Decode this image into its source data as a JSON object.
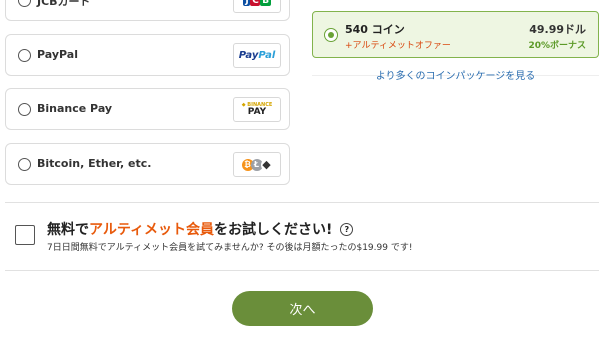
{
  "payment_methods": [
    {
      "label": "JCBカード",
      "logo": "jcb-logo",
      "logo_parts": [
        "J",
        "C",
        "B"
      ]
    },
    {
      "label": "PayPal",
      "logo": "paypal-logo",
      "logo_text_a": "Pay",
      "logo_text_b": "Pal"
    },
    {
      "label": "Binance Pay",
      "logo": "binance-logo",
      "logo_text_top": "◆ BINANCE",
      "logo_text_main": "PAY"
    },
    {
      "label": "Bitcoin, Ether, etc.",
      "logo": "crypto-logo",
      "coins": [
        "₿",
        "Ł",
        "◆"
      ]
    }
  ],
  "package": {
    "coins": "540 コイン",
    "offer": "+アルティメットオファー",
    "price": "49.99ドル",
    "bonus": "20%ボーナス",
    "selected": true
  },
  "more_packages_link": "より多くのコインパッケージを見る",
  "trial": {
    "title_before": "無料で",
    "title_accent": "アルティメット会員",
    "title_after": "をお試しください!",
    "help": "?",
    "description": "7日日間無料でアルティメット会員を試てみませんか? その後は月額たったの$19.99 です!",
    "checked": false
  },
  "next_button": "次へ",
  "colors": {
    "accent_green": "#6a8e3a",
    "accent_orange": "#e85a0c",
    "link_blue": "#2a6db0"
  }
}
